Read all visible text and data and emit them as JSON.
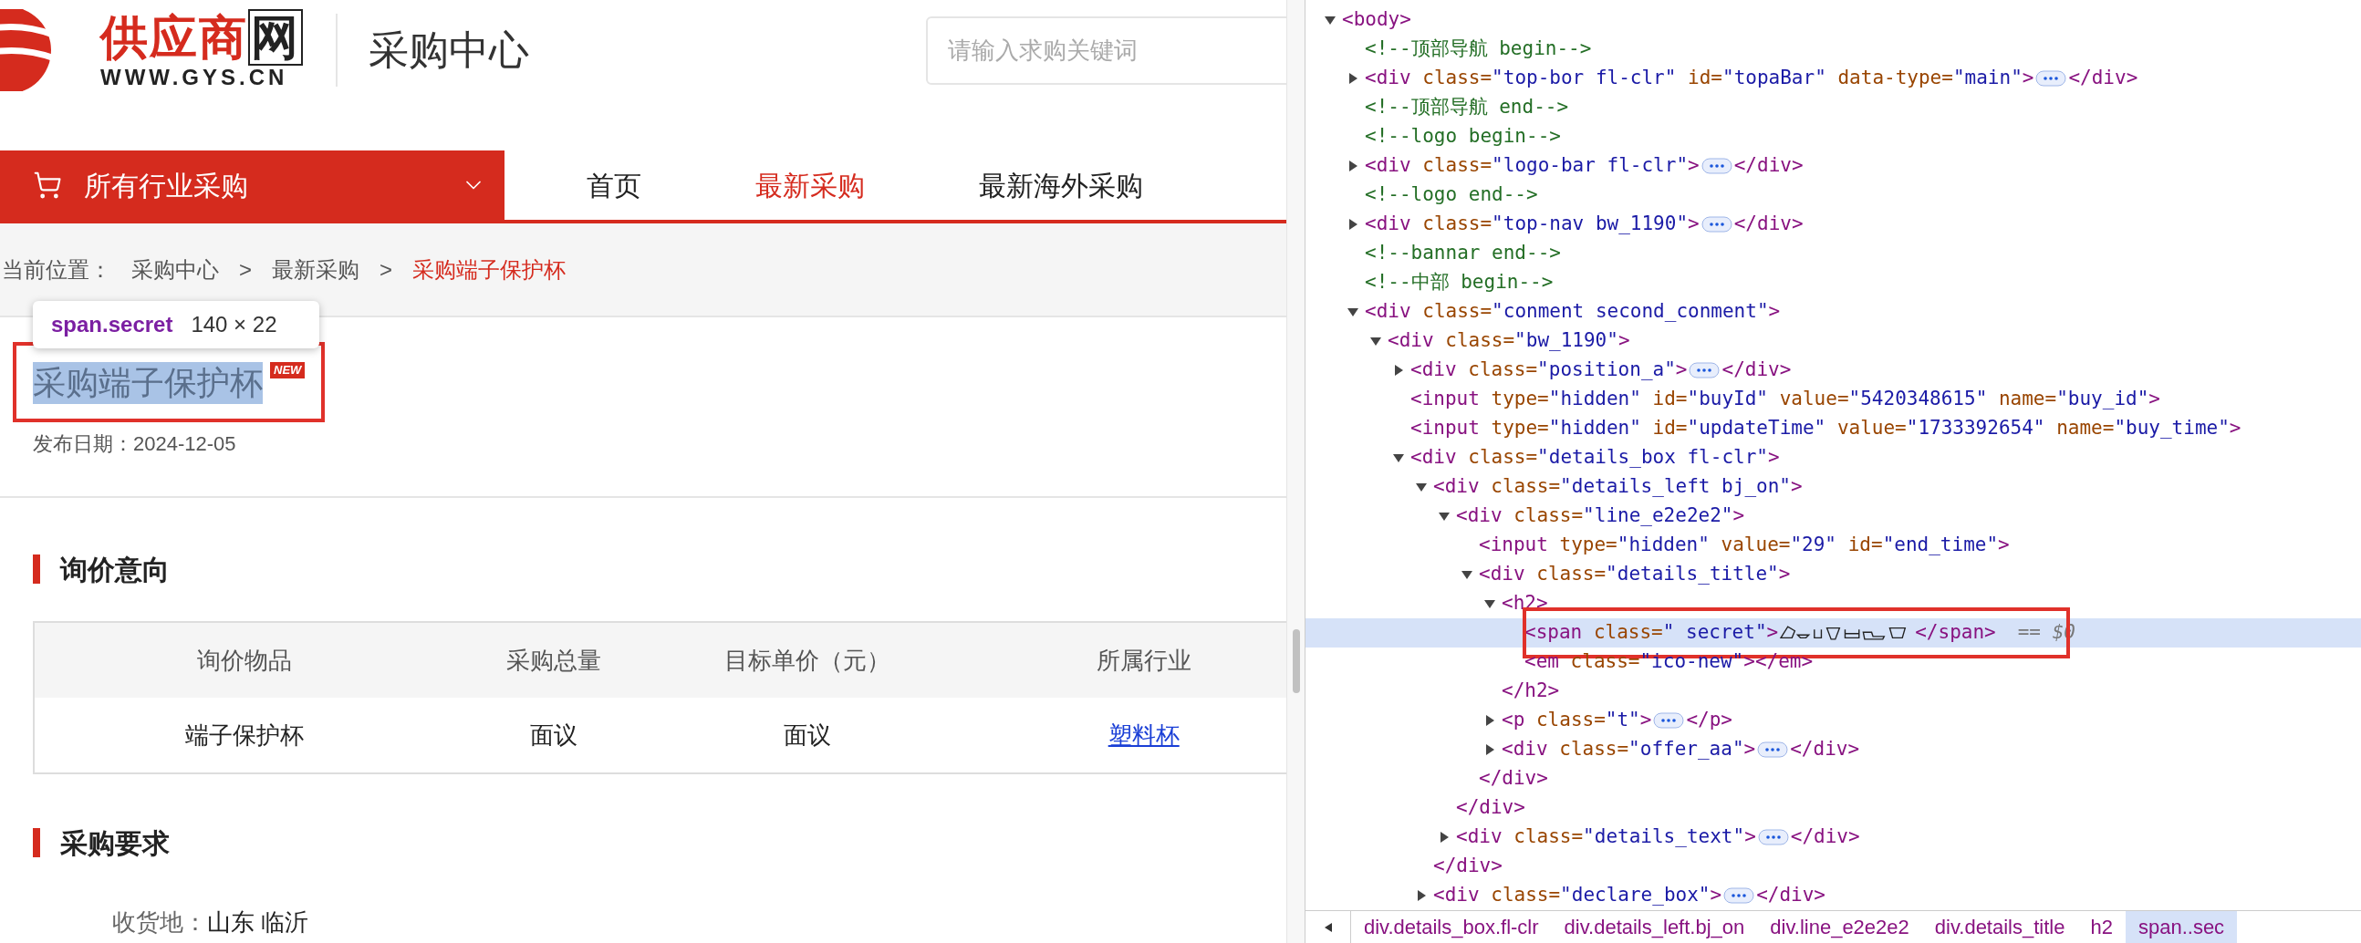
{
  "page": {
    "logo": {
      "name": "供应商网",
      "domain": "WWW.GYS.CN"
    },
    "section_title": "采购中心",
    "search": {
      "placeholder": "请输入求购关键词"
    },
    "category_menu": {
      "label": "所有行业采购"
    },
    "nav": [
      {
        "label": "首页",
        "selected": false
      },
      {
        "label": "最新采购",
        "selected": true
      },
      {
        "label": "最新海外采购",
        "selected": false
      }
    ],
    "breadcrumb": {
      "label": "当前位置：",
      "items": [
        {
          "kind": "link",
          "label": "采购中心",
          "current": false
        },
        {
          "kind": "separator",
          "label": ">"
        },
        {
          "kind": "link",
          "label": "最新采购",
          "current": false
        },
        {
          "kind": "separator",
          "label": ">"
        },
        {
          "kind": "link",
          "label": "采购端子保护杯",
          "current": true
        }
      ]
    },
    "inspector_tooltip": {
      "selector": "span.secret",
      "size": "140 × 22"
    },
    "title": {
      "text": "采购端子保护杯",
      "highlighted": true,
      "badge": "NEW",
      "framed": true
    },
    "date": "发布日期：2024-12-05",
    "inquiry": {
      "heading": "询价意向",
      "table": {
        "columns": [
          "询价物品",
          "采购总量",
          "目标单价（元）",
          "所属行业"
        ],
        "rows": [
          {
            "cells": [
              {
                "kind": "text",
                "text": "端子保护杯"
              },
              {
                "kind": "text",
                "text": "面议"
              },
              {
                "kind": "text",
                "text": "面议"
              },
              {
                "kind": "link",
                "text": "塑料杯"
              }
            ]
          }
        ]
      }
    },
    "requirements": {
      "heading": "采购要求",
      "fields": [
        {
          "label": "收货地：",
          "value": "山东 临沂"
        }
      ]
    }
  },
  "devtools": {
    "tree": [
      {
        "kind": "element",
        "open": "<body>",
        "expanded": true,
        "children": [
          {
            "kind": "comment",
            "text": "<!--顶部导航 begin-->"
          },
          {
            "kind": "element",
            "open": "<div class=\"top-bor fl-clr\" id=\"topaBar\" data-type=\"main\">",
            "close": "</div>",
            "expanded": false
          },
          {
            "kind": "comment",
            "text": "<!--顶部导航 end-->"
          },
          {
            "kind": "comment",
            "text": "<!--logo begin-->"
          },
          {
            "kind": "element",
            "open": "<div class=\"logo-bar fl-clr\">",
            "close": "</div>",
            "expanded": false
          },
          {
            "kind": "comment",
            "text": "<!--logo end-->"
          },
          {
            "kind": "element",
            "open": "<div class=\"top-nav bw_1190\">",
            "close": "</div>",
            "expanded": false
          },
          {
            "kind": "comment",
            "text": "<!--bannar end-->"
          },
          {
            "kind": "comment",
            "text": "<!--中部 begin-->"
          },
          {
            "kind": "element",
            "open": "<div class=\"conment second_conment\">",
            "expanded": true,
            "children": [
              {
                "kind": "element",
                "open": "<div class=\"bw_1190\">",
                "expanded": true,
                "children": [
                  {
                    "kind": "element",
                    "open": "<div class=\"position_a\">",
                    "close": "</div>",
                    "expanded": false
                  },
                  {
                    "kind": "element",
                    "open": "<input type=\"hidden\" id=\"buyId\" value=\"5420348615\" name=\"buy_id\">"
                  },
                  {
                    "kind": "element",
                    "open": "<input type=\"hidden\" id=\"updateTime\" value=\"1733392654\" name=\"buy_time\">"
                  },
                  {
                    "kind": "element",
                    "open": "<div class=\"details_box fl-clr\">",
                    "expanded": true,
                    "children": [
                      {
                        "kind": "element",
                        "open": "<div class=\"details_left bj_on\">",
                        "close": "</div>",
                        "expanded": true,
                        "children": [
                          {
                            "kind": "element",
                            "open": "<div class=\"line_e2e2e2\">",
                            "close": "</div>",
                            "expanded": true,
                            "children": [
                              {
                                "kind": "element",
                                "open": "<input type=\"hidden\" value=\"29\" id=\"end_time\">"
                              },
                              {
                                "kind": "element",
                                "open": "<div class=\"details_title\">",
                                "close": "</div>",
                                "expanded": true,
                                "children": [
                                  {
                                    "kind": "element",
                                    "open": "<h2>",
                                    "close": "</h2>",
                                    "expanded": true,
                                    "children": [
                                      {
                                        "kind": "element",
                                        "open": "<span class=\" secret\">",
                                        "close": "</span>",
                                        "obfuscated_glyphs": true,
                                        "selected": true,
                                        "framed": true,
                                        "suffix": "== $0"
                                      },
                                      {
                                        "kind": "element",
                                        "open": "<em class=\"ico-new\"></em>"
                                      }
                                    ]
                                  },
                                  {
                                    "kind": "element",
                                    "open": "<p class=\"t\">",
                                    "close": "</p>",
                                    "expanded": false
                                  },
                                  {
                                    "kind": "element",
                                    "open": "<div class=\"offer_aa\">",
                                    "close": "</div>",
                                    "expanded": false
                                  }
                                ]
                              }
                            ]
                          },
                          {
                            "kind": "element",
                            "open": "<div class=\"details_text\">",
                            "close": "</div>",
                            "expanded": false
                          }
                        ]
                      },
                      {
                        "kind": "element",
                        "open": "<div class=\"declare_box\">",
                        "close": "</div>",
                        "expanded": false
                      }
                    ]
                  }
                ]
              }
            ]
          }
        ]
      }
    ],
    "breadcrumb": [
      {
        "label": "div.details_box.fl-clr",
        "selected": false
      },
      {
        "label": "div.details_left.bj_on",
        "selected": false
      },
      {
        "label": "div.line_e2e2e2",
        "selected": false
      },
      {
        "label": "div.details_title",
        "selected": false
      },
      {
        "label": "h2",
        "selected": false
      },
      {
        "label": "span..sec",
        "selected": true
      }
    ]
  }
}
